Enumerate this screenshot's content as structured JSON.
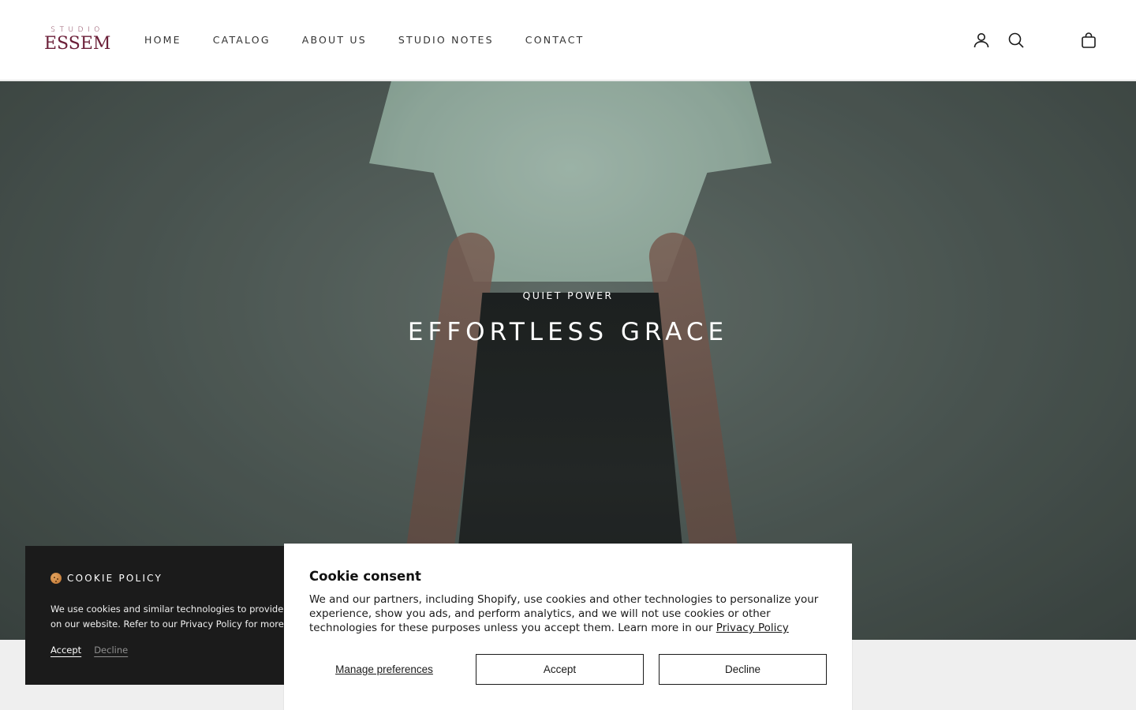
{
  "brand": {
    "logo_top": "STUDIO",
    "logo_main": "ESSEM",
    "accent_color": "#6b1f38"
  },
  "nav": {
    "items": [
      {
        "label": "HOME"
      },
      {
        "label": "CATALOG"
      },
      {
        "label": "ABOUT US"
      },
      {
        "label": "STUDIO NOTES"
      },
      {
        "label": "CONTACT"
      }
    ]
  },
  "header_icons": {
    "account": "user-icon",
    "search": "search-icon",
    "cart": "shopping-bag-icon"
  },
  "hero": {
    "eyebrow": "QUIET POWER",
    "title": "EFFORTLESS GRACE"
  },
  "cookie_policy": {
    "title": "COOKIE POLICY",
    "text": "We use cookies and similar technologies to provide the best experience on our website. Refer to our Privacy Policy for more information.",
    "accept_label": "Accept",
    "decline_label": "Decline",
    "background": "#1b1b1b"
  },
  "consent": {
    "title": "Cookie consent",
    "text": "We and our partners, including Shopify, use cookies and other technologies to personalize your experience, show you ads, and perform analytics, and we will not use cookies or other technologies for these purposes unless you accept them. Learn more in our",
    "privacy_link": "Privacy Policy",
    "manage_label": "Manage preferences",
    "accept_label": "Accept",
    "decline_label": "Decline"
  }
}
